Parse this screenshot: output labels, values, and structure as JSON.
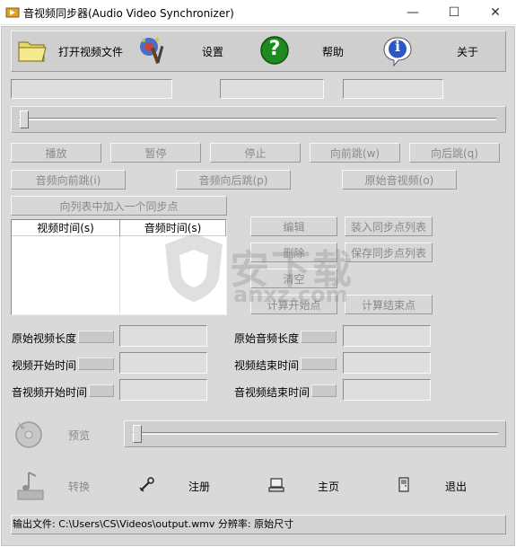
{
  "window": {
    "title": "音视频同步器(Audio Video Synchronizer)",
    "minimize_glyph": "—",
    "maximize_glyph": "☐",
    "close_glyph": "✕"
  },
  "toolbar": {
    "open_video_label": "打开视频文件",
    "settings_label": "设置",
    "help_label": "帮助",
    "about_label": "关于",
    "help_glyph": "?",
    "about_glyph": "i"
  },
  "fields": {
    "top_left": "",
    "top_middle": "",
    "top_right": ""
  },
  "playback": {
    "play": "播放",
    "pause": "暂停",
    "stop": "停止",
    "jump_forward": "向前跳(w)",
    "jump_backward": "向后跳(q)",
    "audio_jump_forward": "音频向前跳(i)",
    "audio_jump_backward": "音频向后跳(p)",
    "original_av": "原始音视频(o)",
    "add_sync_point": "向列表中加入一个同步点"
  },
  "sync_list": {
    "columns": [
      "视频时间(s)",
      "音频时间(s)"
    ],
    "rows": []
  },
  "list_actions": {
    "edit": "编辑",
    "load_list": "装入同步点列表",
    "delete": "删除",
    "save_list": "保存同步点列表",
    "clear": "清空",
    "calc_start": "计算开始点",
    "calc_end": "计算结束点"
  },
  "info": {
    "orig_video_length": "原始视频长度",
    "orig_audio_length": "原始音频长度",
    "video_start": "视频开始时间",
    "video_end": "视频结束时间",
    "av_start": "音视频开始时间",
    "av_end": "音视频结束时间"
  },
  "preview": {
    "label": "预览"
  },
  "bottom_bar": {
    "convert": "转换",
    "register": "注册",
    "home": "主页",
    "exit": "退出"
  },
  "status": {
    "text": "输出文件: C:\\Users\\CS\\Videos\\output.wmv    分辨率: 原始尺寸"
  },
  "watermark": {
    "text": "安下载",
    "subtext": "anxz.com"
  },
  "colors": {
    "face": "#d9d9d9",
    "disabled_text": "#8a8a8a",
    "help_green": "#1f8a1f",
    "folder_yellow": "#e8d86a"
  }
}
